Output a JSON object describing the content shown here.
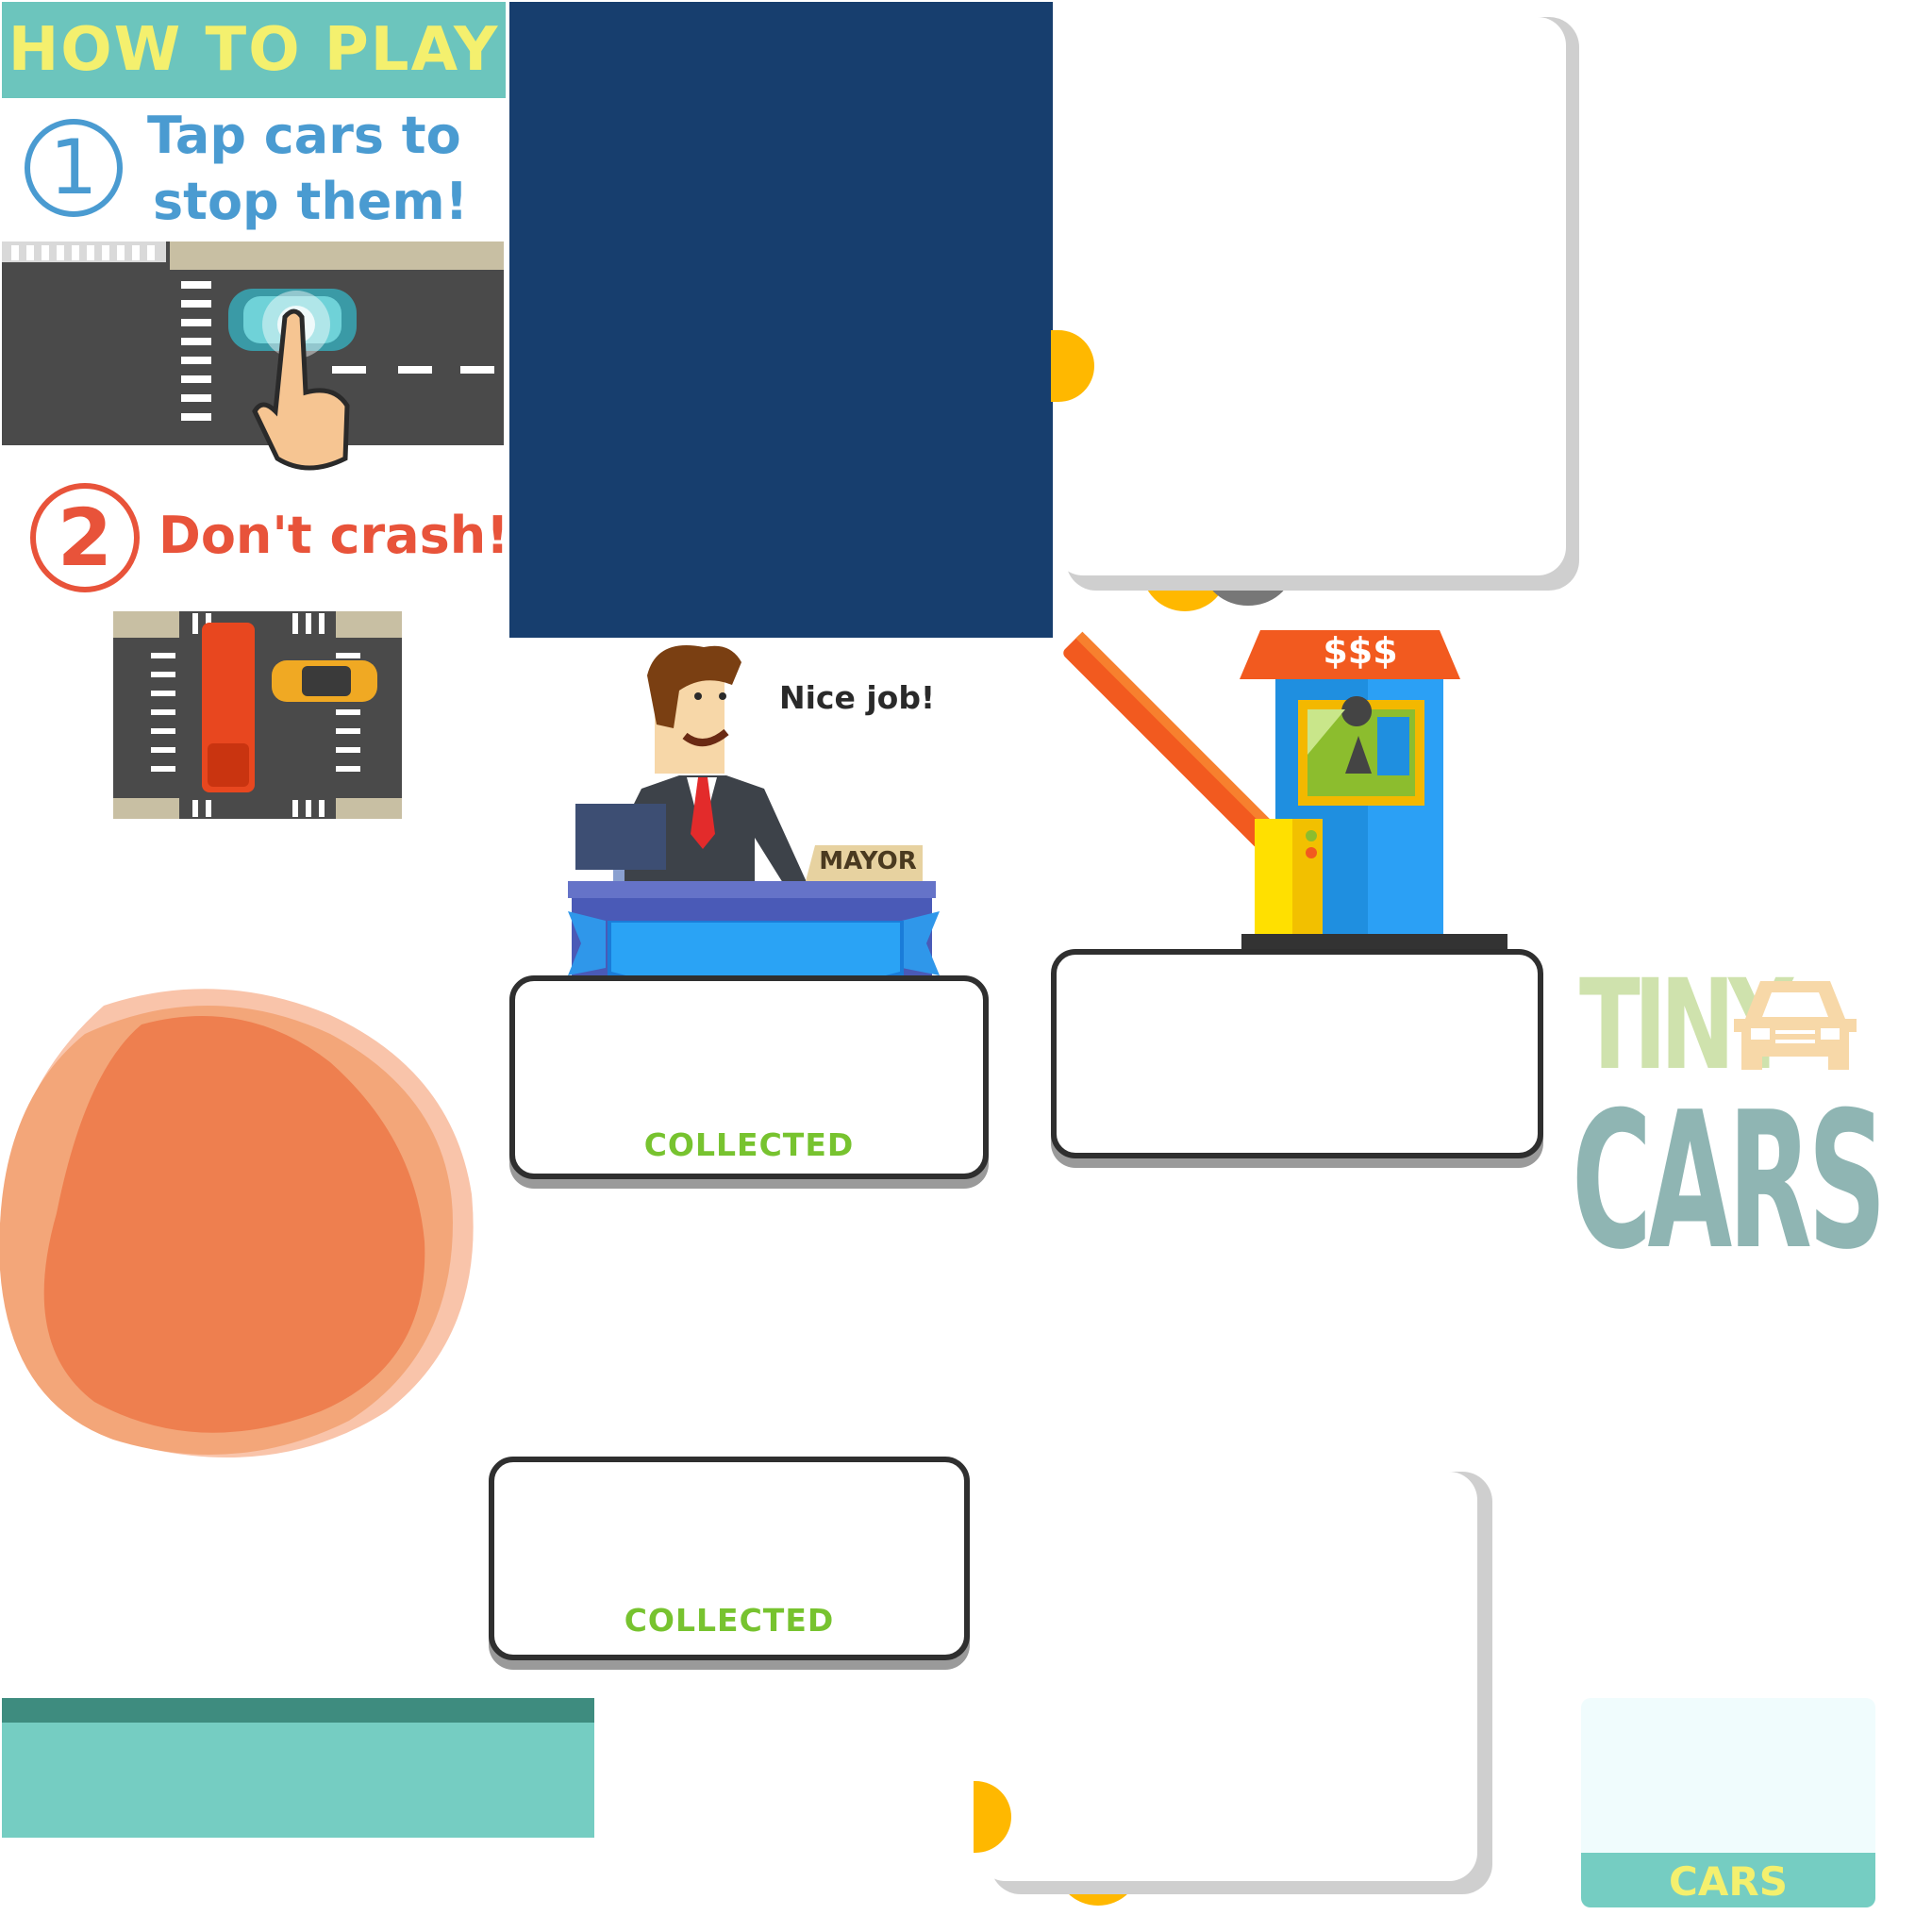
{
  "how_to_play": {
    "title": "HOW TO PLAY",
    "step1_number": "1",
    "step1_line1": "Tap cars to",
    "step1_line2": "stop them!",
    "step2_number": "2",
    "step2_text": "Don't crash!"
  },
  "mayor_scene": {
    "speech": "Nice job!",
    "nameplate": "MAYOR"
  },
  "toll_booth": {
    "sign": "$$$"
  },
  "panels": {
    "collected_label_1": "COLLECTED",
    "collected_label_2": "COLLECTED",
    "cars_label": "CARS"
  },
  "logo": {
    "line1": "TINY",
    "line2": "CARS"
  },
  "colors": {
    "header_teal": "#6cc5bd",
    "header_yellow": "#f4f06e",
    "navy_panel": "#173e6e",
    "step1_blue": "#4a9bd1",
    "step2_red": "#e8533a",
    "collected_green": "#77c32f",
    "blob_orange": "#ee7f4f",
    "bar_teal": "#75cdc2",
    "bar_dark_teal": "#3e8c7f"
  }
}
